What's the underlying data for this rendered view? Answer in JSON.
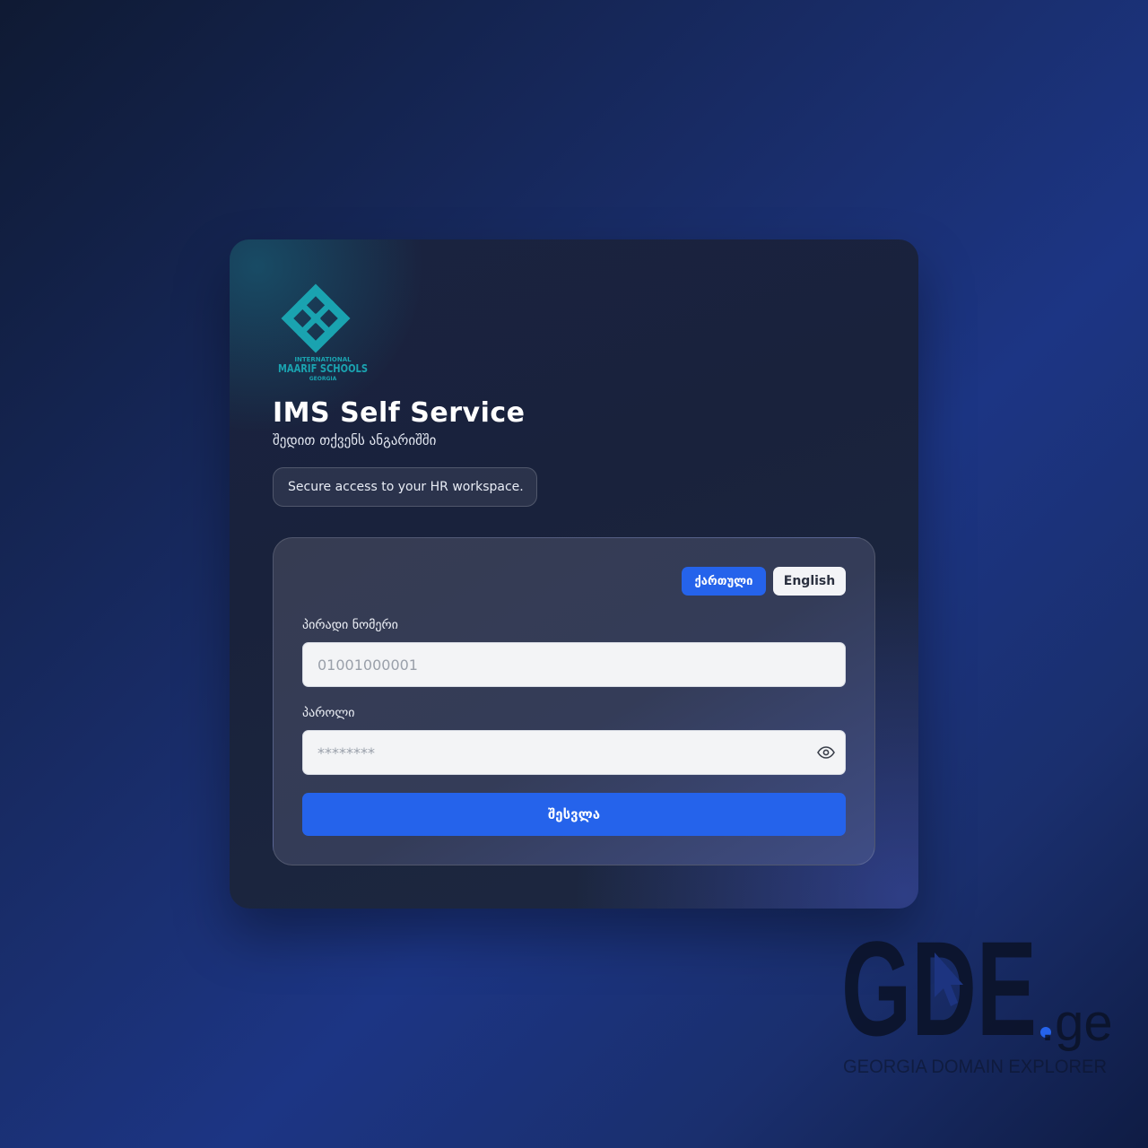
{
  "logo": {
    "line1": "INTERNATIONAL",
    "line2": "MAARIF SCHOOLS",
    "line3": "GEORGIA",
    "color": "#1aa3b0"
  },
  "header": {
    "title": "IMS Self Service",
    "subtitle": "შედით თქვენს ანგარიშში",
    "tagline": "Secure access to your HR workspace."
  },
  "language": {
    "georgian_label": "ქართული",
    "english_label": "English",
    "active": "ქართული"
  },
  "form": {
    "id_label": "პირადი ნომერი",
    "id_placeholder": "01001000001",
    "password_label": "პაროლი",
    "password_placeholder": "********",
    "show_password_icon": "eye-icon",
    "submit_label": "შესვლა"
  },
  "watermark": {
    "brand": "GDE",
    "tld": ".ge",
    "tagline": "GEORGIA DOMAIN EXPLORER"
  },
  "colors": {
    "accent": "#2563eb",
    "logo_teal": "#1aa3b0"
  }
}
